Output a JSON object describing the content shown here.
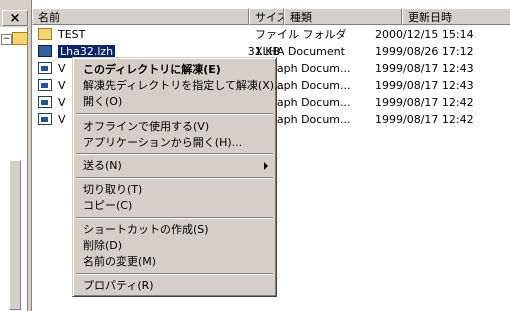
{
  "left_pane": {
    "close_label": "×",
    "tree_expander_label": "−"
  },
  "columns": {
    "name": "名前",
    "size": "サイズ",
    "type": "種類",
    "date": "更新日時"
  },
  "files": [
    {
      "icon": "folder-icon",
      "name": "TEST",
      "size": "",
      "type": "ファイル フォルダ",
      "date": "2000/12/15 15:14"
    },
    {
      "icon": "archive-icon",
      "name": "Lha32.lzh",
      "size": "31 KB",
      "type": "XLHA Document",
      "date": "1999/08/26 17:12",
      "selected": true
    },
    {
      "icon": "document-icon",
      "name": "V",
      "size": "",
      "type": "rtGraph Docum...",
      "date": "1999/08/17 12:43"
    },
    {
      "icon": "document-icon",
      "name": "V",
      "size": "",
      "type": "rtGraph Docum...",
      "date": "1999/08/17 12:43"
    },
    {
      "icon": "document-icon",
      "name": "V",
      "size": "",
      "type": "rtGraph Docum...",
      "date": "1999/08/17 12:42"
    },
    {
      "icon": "document-icon",
      "name": "V",
      "size": "",
      "type": "rtGraph Docum...",
      "date": "1999/08/17 12:42"
    }
  ],
  "context_menu": {
    "items": [
      "このディレクトリに解凍(E)",
      "解凍先ディレクトリを指定して解凍(X)...",
      "開く(O)",
      "オフラインで使用する(V)",
      "アプリケーションから開く(H)...",
      "送る(N)",
      "切り取り(T)",
      "コピー(C)",
      "ショートカットの作成(S)",
      "削除(D)",
      "名前の変更(M)",
      "プロパティ(R)"
    ]
  }
}
